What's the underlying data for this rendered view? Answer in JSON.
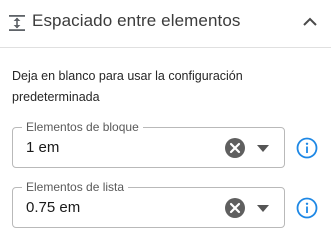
{
  "panel": {
    "title": "Espaciado entre elementos",
    "header_icon": "vertical-spacing-icon",
    "collapse_icon": "chevron-up-icon"
  },
  "help_text": "Deja en blanco para usar la configuración predeterminada",
  "fields": {
    "block": {
      "label": "Elementos de bloque",
      "value": "1 em",
      "clear_icon": "clear-icon",
      "dropdown_icon": "dropdown-arrow-icon",
      "info_icon": "info-icon"
    },
    "list": {
      "label": "Elementos de lista",
      "value": "0.75 em",
      "clear_icon": "clear-icon",
      "dropdown_icon": "dropdown-arrow-icon",
      "info_icon": "info-icon"
    }
  },
  "colors": {
    "accent": "#1e88e5",
    "clear_icon_bg": "#5f5f5f",
    "border": "#b9b9b9"
  }
}
